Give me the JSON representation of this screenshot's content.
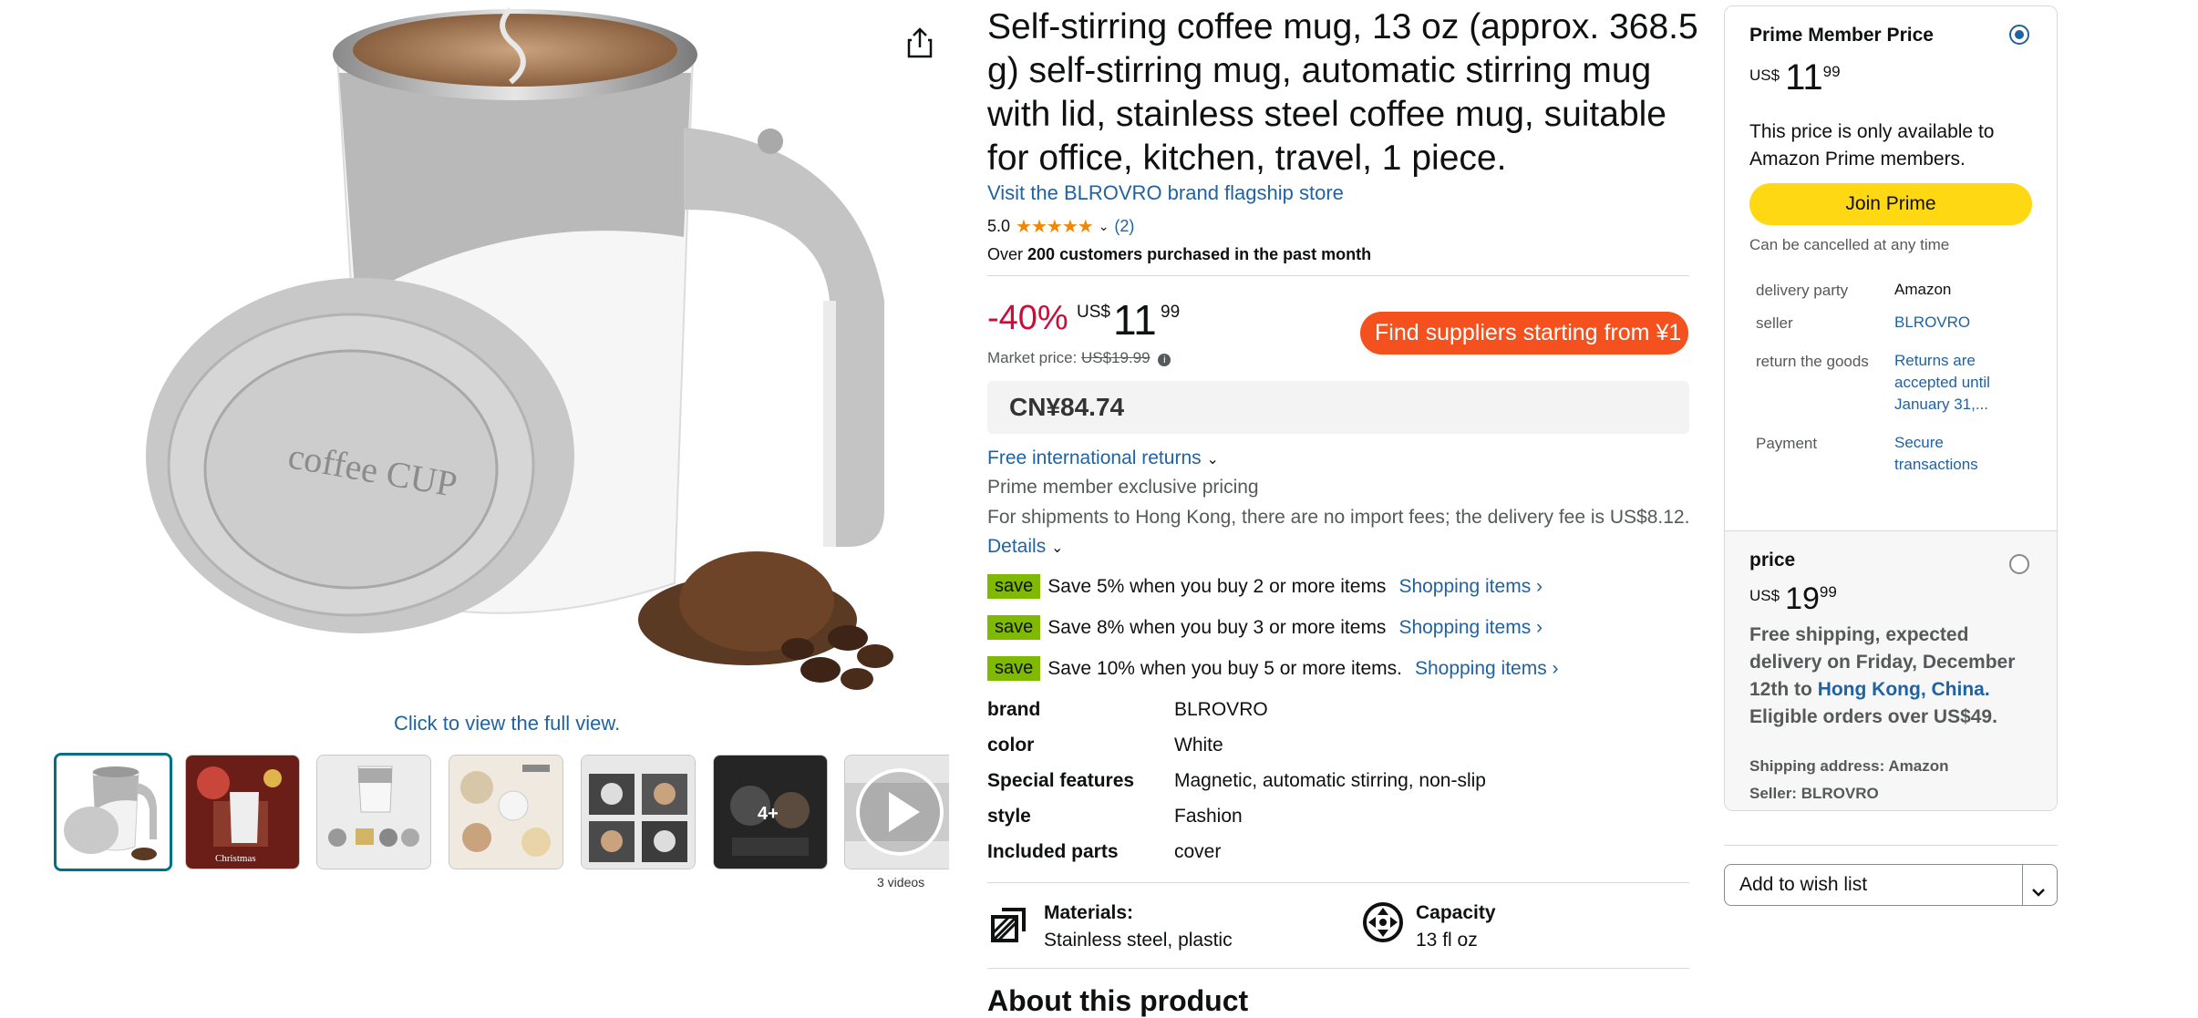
{
  "gallery": {
    "click_full_view": "Click to view the full view.",
    "lid_text": "coffee CUP",
    "thumb_caption_christmas": "Christmas",
    "thumb_caption_more": "4+",
    "videos_caption": "3 videos"
  },
  "product": {
    "title": "Self-stirring coffee mug, 13 oz (approx. 368.5 g) self-stirring mug, automatic stirring mug with lid, stainless steel coffee mug, suitable for office, kitchen, travel, 1 piece.",
    "brand_link": "Visit the BLROVRO brand flagship store",
    "rating": "5.0",
    "stars": "★★★★★",
    "review_count": "(2)",
    "bought_prefix": "Over",
    "bought_bold": "200 customers purchased in the past month",
    "discount": "-40%",
    "currency": "US$",
    "price_whole": "11",
    "price_fraction": "99",
    "market_label": "Market price:",
    "market_price": "US$19.99",
    "find_suppliers": "Find suppliers   starting from ¥1",
    "cny_price": "CN¥84.74",
    "returns_link": "Free international returns",
    "prime_exclusive": "Prime member exclusive pricing",
    "shipping_note": "For shipments to Hong Kong, there are no import fees; the delivery fee is US$8.12.",
    "details_link": "Details",
    "save_tag": "save",
    "saves": [
      {
        "text": "Save 5% when you buy 2 or more items",
        "link": "Shopping items ›"
      },
      {
        "text": "Save 8% when you buy 3 or more items",
        "link": "Shopping items ›"
      },
      {
        "text": "Save 10% when you buy 5 or more items.",
        "link": "Shopping items ›"
      }
    ],
    "specs": [
      {
        "label": "brand",
        "value": "BLROVRO"
      },
      {
        "label": "color",
        "value": "White"
      },
      {
        "label": "Special features",
        "value": "Magnetic, automatic stirring, non-slip"
      },
      {
        "label": "style",
        "value": "Fashion"
      },
      {
        "label": "Included parts",
        "value": "cover"
      }
    ],
    "features": [
      {
        "title": "Materials:",
        "value": "Stainless steel, plastic",
        "icon": "materials-icon"
      },
      {
        "title": "Capacity",
        "value": "13 fl oz",
        "icon": "capacity-icon"
      }
    ],
    "about_heading": "About this product"
  },
  "buybox": {
    "prime_heading": "Prime Member Price",
    "prime_currency": "US$",
    "prime_whole": "11",
    "prime_fraction": "99",
    "prime_note": "This price is only available to Amazon Prime members.",
    "join_prime": "Join Prime",
    "cancel_note": "Can be cancelled at any time",
    "info": [
      {
        "label": "delivery party",
        "value": "Amazon"
      },
      {
        "label": "seller",
        "value": "BLROVRO"
      },
      {
        "label": "return the goods",
        "value": "Returns are accepted until January 31,..."
      },
      {
        "label": "Payment",
        "value": "Secure transactions"
      }
    ],
    "price_heading": "price",
    "price_currency": "US$",
    "price_whole": "19",
    "price_fraction": "99",
    "shipping_text": "Free shipping, expected delivery on Friday, December 12th to",
    "shipping_link": "Hong Kong, China.",
    "eligible": "Eligible orders over US$49.",
    "shipping_address": "Shipping address: Amazon",
    "seller_line": "Seller: BLROVRO",
    "wishlist": "Add to wish list"
  },
  "colors": {
    "accent_link": "#2162a1",
    "discount_red": "#cc0c39",
    "find_suppliers_orange": "#f4511e",
    "join_prime_yellow": "#ffd814",
    "save_green": "#7fba00",
    "selected_thumb": "#007185"
  }
}
